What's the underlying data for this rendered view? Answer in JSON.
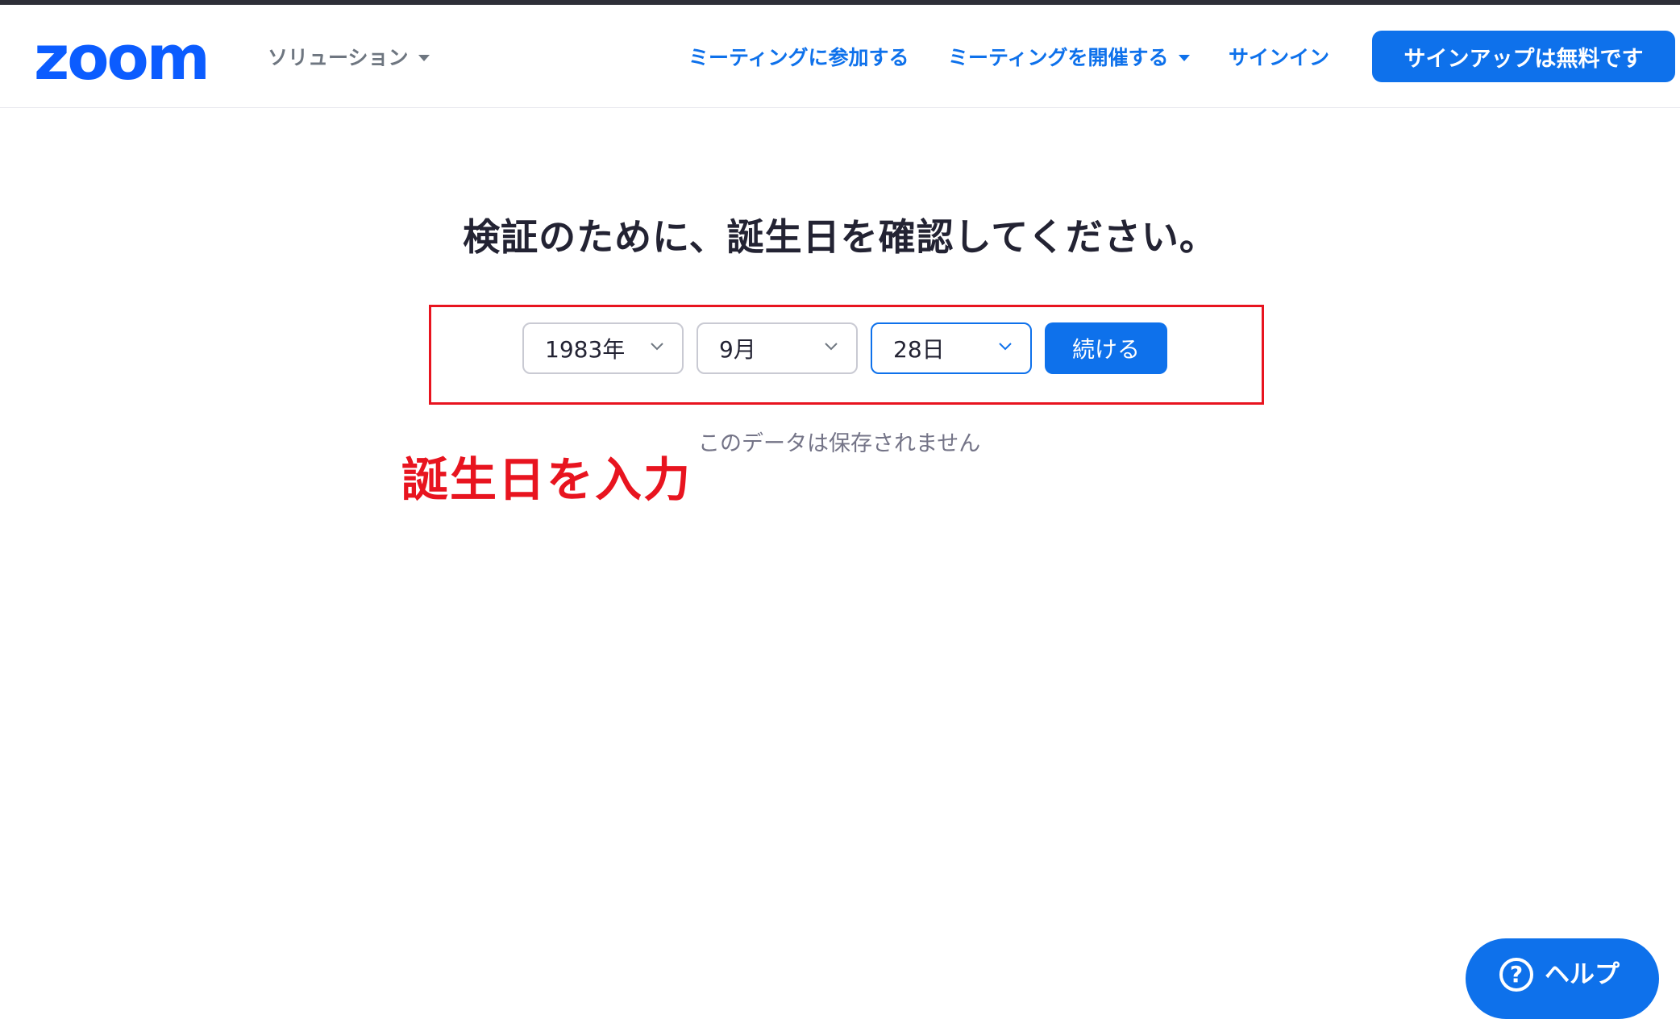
{
  "header": {
    "logo_text": "zoom",
    "solutions_label": "ソリューション",
    "join_label": "ミーティングに参加する",
    "host_label": "ミーティングを開催する",
    "signin_label": "サインイン",
    "signup_label": "サインアップは無料です"
  },
  "main": {
    "title": "検証のために、誕生日を確認してください。",
    "year_value": "1983年",
    "month_value": "9月",
    "day_value": "28日",
    "continue_label": "続ける",
    "note": "このデータは保存されません"
  },
  "annotation": {
    "text": "誕生日を入力",
    "color": "#e8141f"
  },
  "help": {
    "icon": "question-circle-icon",
    "label": "ヘルプ"
  },
  "colors": {
    "brand": "#0e71eb",
    "text": "#232333",
    "muted": "#747487"
  }
}
